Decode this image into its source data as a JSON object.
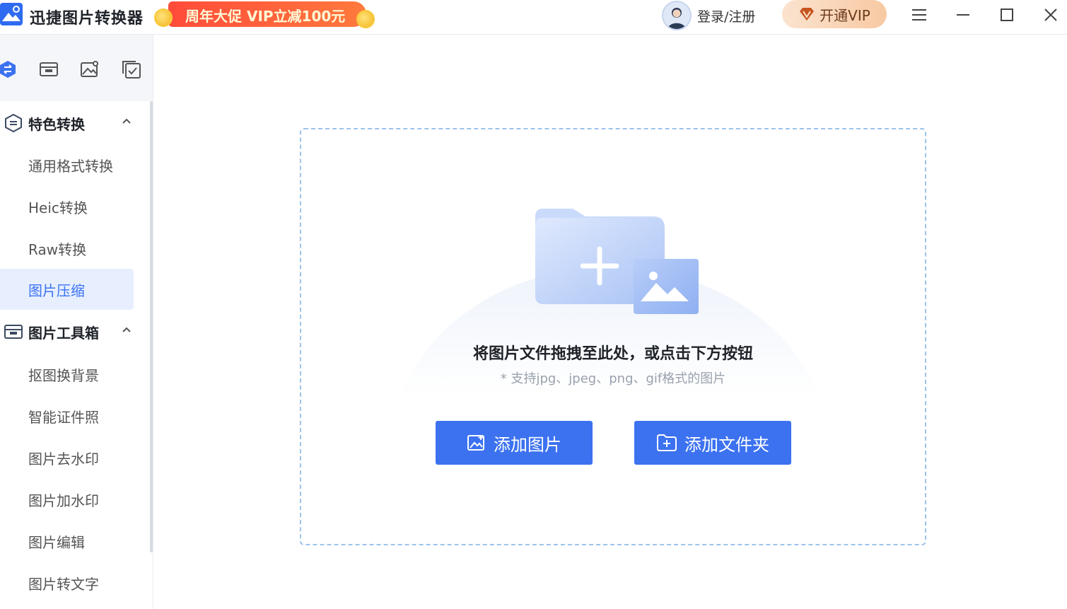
{
  "app": {
    "title": "迅捷图片转换器"
  },
  "promo": {
    "text": "周年大促 VIP立减100元"
  },
  "header": {
    "login_label": "登录/注册",
    "vip_label": "开通VIP"
  },
  "sidebar": {
    "tabs": [
      {
        "icon": "convert-icon",
        "active": true
      },
      {
        "icon": "toolbox-icon"
      },
      {
        "icon": "image-edit-icon"
      },
      {
        "icon": "batch-check-icon"
      }
    ],
    "sections": [
      {
        "label": "特色转换",
        "icon": "convert-shield-icon",
        "items": [
          "通用格式转换",
          "Heic转换",
          "Raw转换",
          "图片压缩"
        ],
        "active_item": "图片压缩"
      },
      {
        "label": "图片工具箱",
        "icon": "toolbox-icon",
        "items": [
          "抠图换背景",
          "智能证件照",
          "图片去水印",
          "图片加水印",
          "图片编辑",
          "图片转文字"
        ]
      }
    ]
  },
  "main": {
    "drop_title": "将图片文件拖拽至此处，或点击下方按钮",
    "drop_sub": "* 支持jpg、jpeg、png、gif格式的图片",
    "add_image_label": "添加图片",
    "add_folder_label": "添加文件夹"
  },
  "colors": {
    "primary": "#3c72f0",
    "active_bg": "#e7efff",
    "promo": "#ff4b3a"
  }
}
